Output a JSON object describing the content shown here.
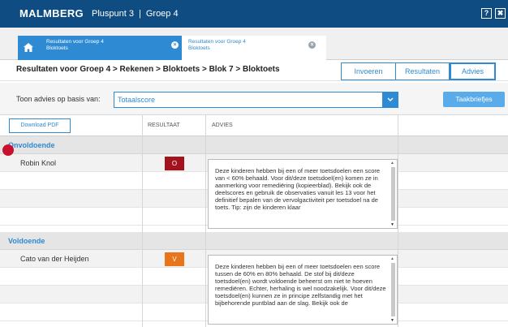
{
  "header": {
    "brand": "MALMBERG",
    "product": "Pluspunt 3",
    "separator": "|",
    "group": "Groep 4",
    "help_label": "?",
    "close_label": "✖"
  },
  "tabs": [
    {
      "title": "Resultaten voor Groep 4",
      "subtitle": "Bloktoets",
      "close": "×"
    },
    {
      "title": "Resultaten voor Groep 4",
      "subtitle": "Bloktoets",
      "close": "×"
    }
  ],
  "breadcrumb": "Resultaten voor Groep 4 > Rekenen > Bloktoets > Blok 7 > Bloktoets",
  "view_buttons": {
    "invoeren": "Invoeren",
    "resultaten": "Resultaten",
    "advies": "Advies"
  },
  "filter": {
    "label": "Toon advies op basis van:",
    "selected": "Totaalscore"
  },
  "taakbriefjes_label": "Taakbriefjes",
  "table": {
    "download_label": "Download PDF",
    "col_resultaat": "RESULTAAT",
    "col_advies": "ADVIES",
    "sections": [
      {
        "title": "Onvoldoende",
        "student": "Robin Knol",
        "badge": "O",
        "color": "#a3121d",
        "advice": "Deze kinderen hebben bij een of meer toetsdoelen een score van < 60% behaald. Voor dit/deze toetsdoel(en) komen ze in aanmerking voor remediëring (kopieerblad). Bekijk ook de deelscores en gebruik de observaties vanuit les 13 voor het definitief bepalen van de vervolgactiviteit per toetsdoel na de toets. Tip: zijn de kinderen klaar"
      },
      {
        "title": "Voldoende",
        "student": "Cato van der Heijden",
        "badge": "V",
        "color": "#e8741c",
        "advice": "Deze kinderen hebben bij een of meer toetsdoelen een score tussen de 60% en 80% behaald. De stof bij dit/deze toetsdoel(en) wordt voldoende beheerst om niet te hoeven remediëren. Echter, herhaling is wel noodzakelijk. Voor dit/deze toetsdoel(en) kunnen ze in principe zelfstandig met het bijbehorende puntblad aan de slag. Bekijk ook de"
      }
    ]
  },
  "colors": {
    "topbar": "#0f4c81",
    "accent": "#2e8ad2",
    "onvoldoende": "#a3121d",
    "voldoende": "#e8741c",
    "marker": "#c8102e"
  }
}
